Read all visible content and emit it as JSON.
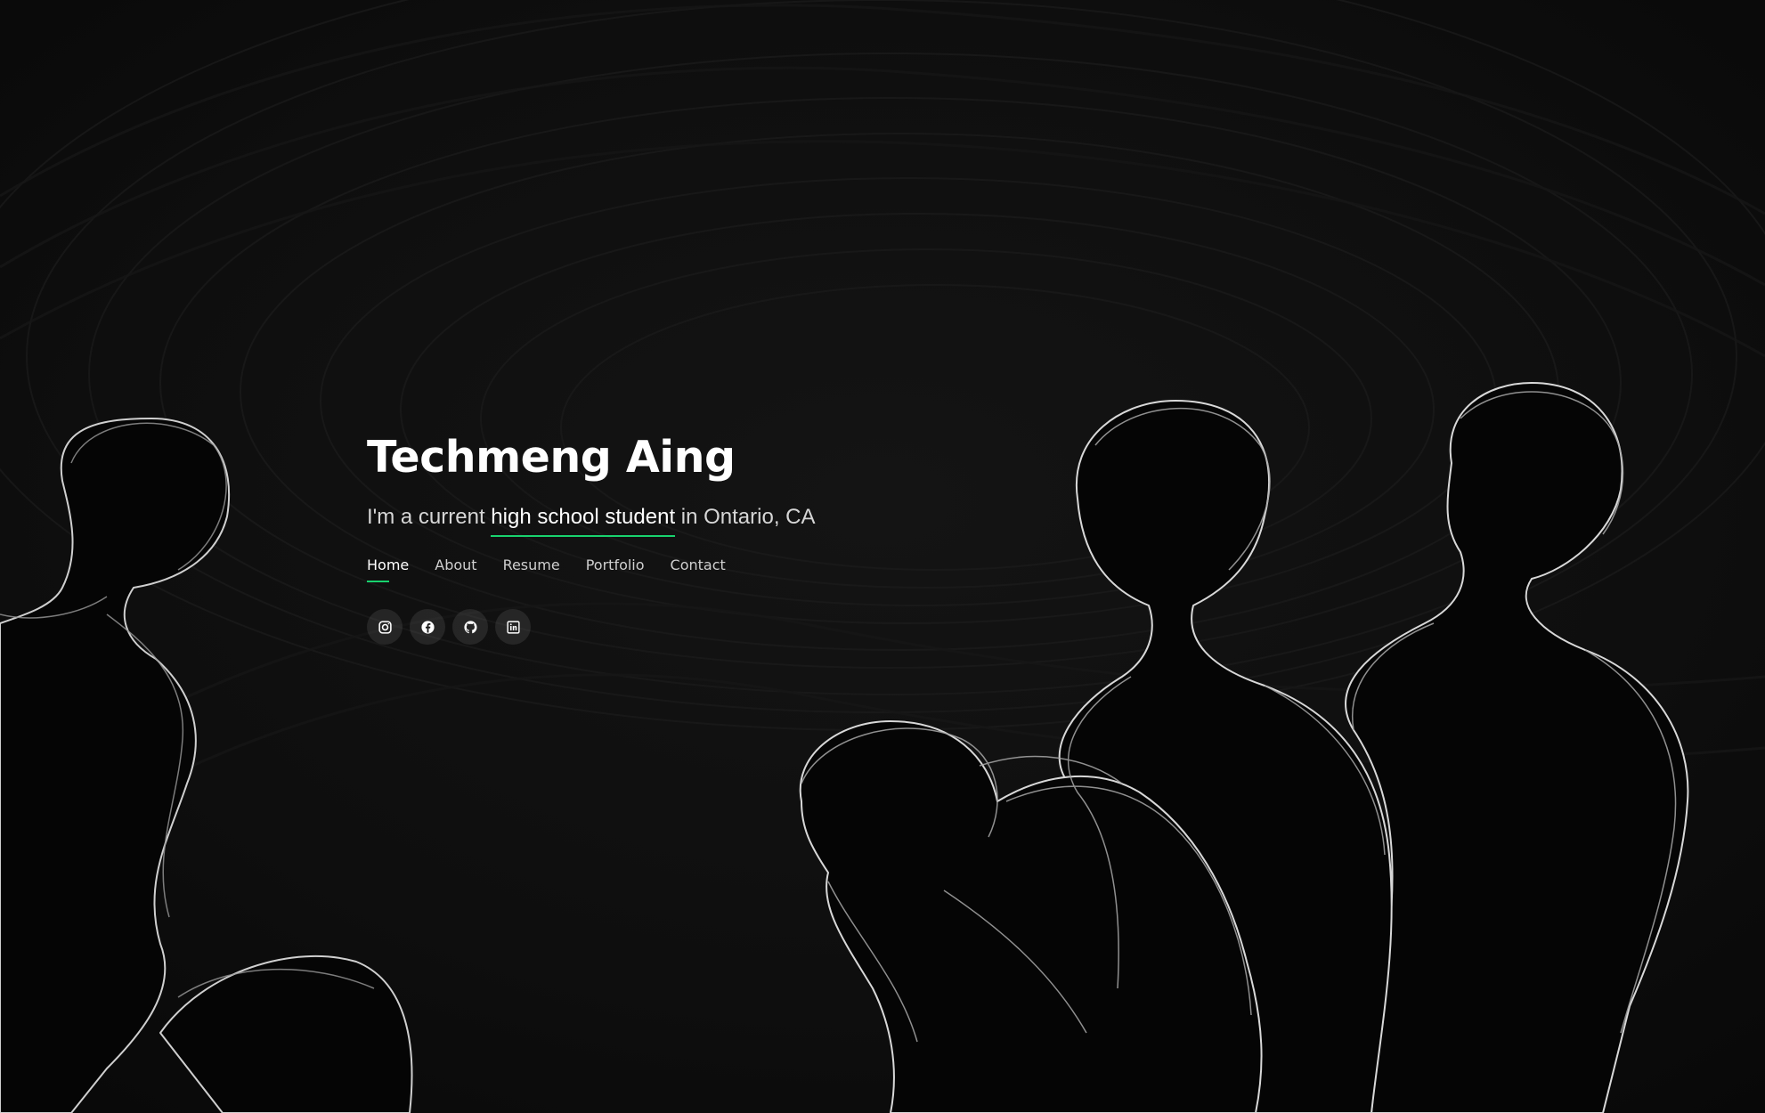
{
  "hero": {
    "name": "Techmeng Aing",
    "subtitle_before": "I'm a current ",
    "subtitle_highlight": "high school student",
    "subtitle_after": " in Ontario, CA"
  },
  "nav": {
    "items": [
      {
        "label": "Home",
        "active": true
      },
      {
        "label": "About",
        "active": false
      },
      {
        "label": "Resume",
        "active": false
      },
      {
        "label": "Portfolio",
        "active": false
      },
      {
        "label": "Contact",
        "active": false
      }
    ]
  },
  "socials": [
    {
      "icon": "instagram-icon"
    },
    {
      "icon": "facebook-icon"
    },
    {
      "icon": "github-icon"
    },
    {
      "icon": "linkedin-icon"
    }
  ],
  "colors": {
    "background": "#0b0b0b",
    "accent": "#18d26e",
    "text": "#ffffff",
    "muted_text": "#d6d6d6"
  }
}
